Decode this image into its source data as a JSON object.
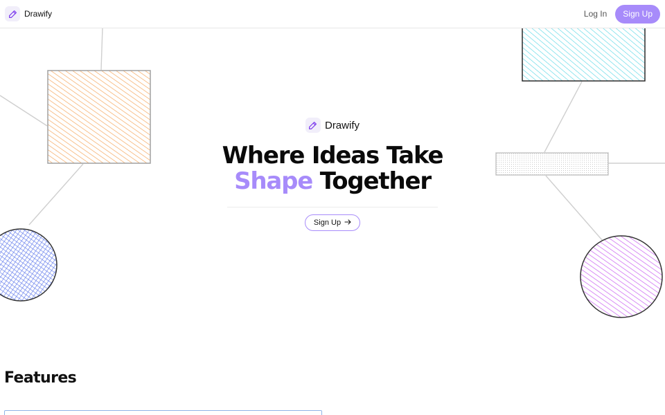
{
  "navbar": {
    "brand_name": "Drawify",
    "brand_icon": "pencil-icon",
    "login_label": "Log In",
    "signup_label": "Sign Up"
  },
  "hero": {
    "brand_name": "Drawify",
    "headline_line1": "Where Ideas Take",
    "headline_accent": "Shape",
    "headline_rest": " Together",
    "cta_label": "Sign Up",
    "cta_icon": "arrow-right-icon"
  },
  "features": {
    "title": "Features"
  },
  "colors": {
    "accent": "#a78bfa",
    "orange_sketch": "#f6a55a",
    "cyan_sketch": "#56d8e6",
    "blue_sketch": "#4f6de8",
    "purple_sketch": "#c45bf0",
    "gray_sketch": "#b9b9b9"
  }
}
